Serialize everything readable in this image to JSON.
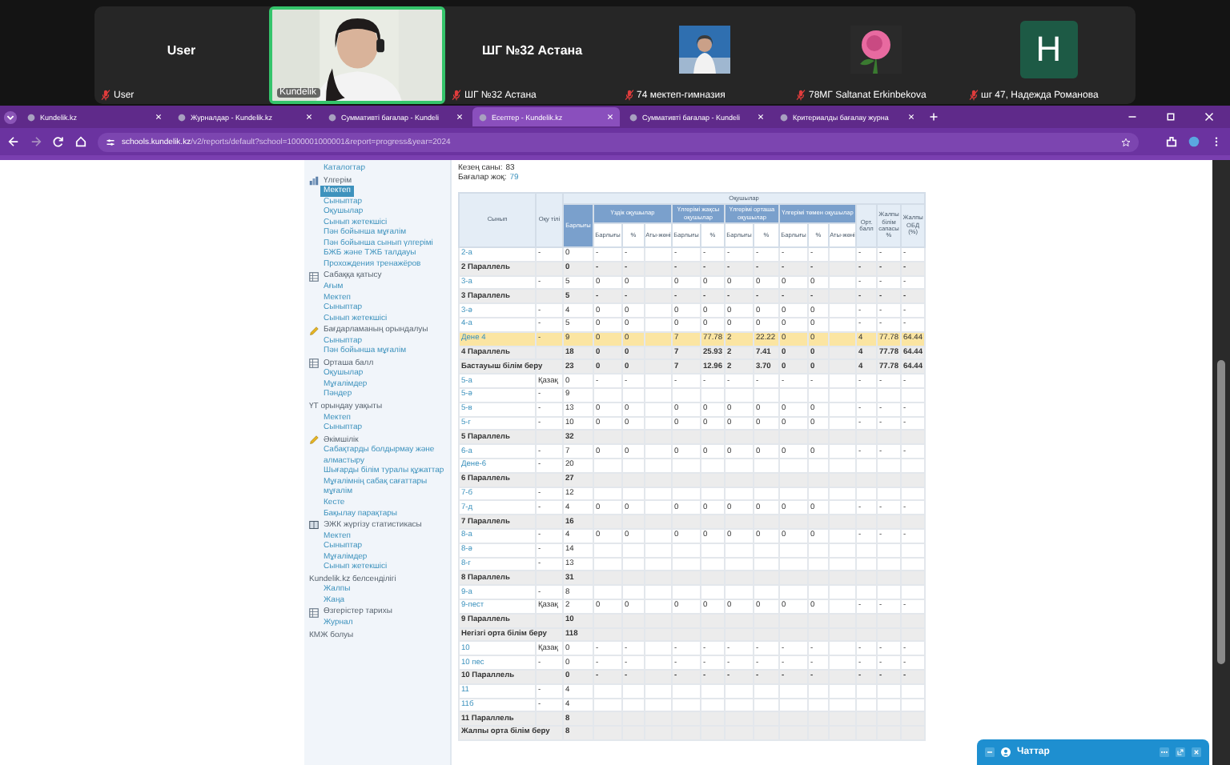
{
  "meeting": {
    "participants": [
      {
        "kind": "name",
        "name": "User",
        "label": "User",
        "muted": true,
        "speaking": false
      },
      {
        "kind": "video",
        "label": "Kundelik",
        "muted": false,
        "speaking": true
      },
      {
        "kind": "name",
        "name": "ШГ №32 Астана",
        "label": "ШГ №32 Астана",
        "muted": true,
        "speaking": false
      },
      {
        "label": "74 мектеп-гимназия",
        "muted": true,
        "speaking": false
      },
      {
        "label": "78МГ Saltanat Erkinbekova",
        "muted": true,
        "speaking": false
      },
      {
        "kind": "avatar",
        "initial": "H",
        "label": "шг 47, Надежда Романова",
        "muted": true,
        "speaking": false
      }
    ]
  },
  "browser": {
    "tabs": [
      {
        "title": "Kundelik.kz",
        "selected": false
      },
      {
        "title": "Журналдар - Kundelik.kz",
        "selected": false
      },
      {
        "title": "Суммативті бағалар - Kundeli",
        "selected": false
      },
      {
        "title": "Есептер - Kundelik.kz",
        "selected": true
      },
      {
        "title": "Суммативті бағалар - Kundeli",
        "selected": false
      },
      {
        "title": "Критериалды бағалау журна",
        "selected": false
      }
    ],
    "url": "**schools.kundelik.kz**/v2/reports/default?school=1000001000001&report=progress&year=2024"
  },
  "sidebar": {
    "groups": [
      {
        "items": [
          {
            "label": "Каталогтар",
            "selected": false
          }
        ]
      },
      {
        "kind": "chart",
        "title": "Үлгерім",
        "items": [
          {
            "label": "Мектеп",
            "selected": true
          },
          {
            "label": "Сыныптар",
            "selected": false
          },
          {
            "label": "Оқушылар",
            "selected": false
          },
          {
            "label": "Сынып жетекшісі",
            "selected": false
          },
          {
            "label": "Пән бойынша мұғалім",
            "selected": false
          },
          {
            "label": "Пән бойынша сынып үлгерімі",
            "selected": false
          },
          {
            "label": "БЖБ және ТЖБ талдауы",
            "selected": false
          },
          {
            "label": "Прохождения тренажёров",
            "selected": false
          }
        ]
      },
      {
        "kind": "grid",
        "title": "Сабаққа қатысу",
        "items": [
          {
            "label": "Ағым",
            "selected": false
          },
          {
            "label": "Мектеп",
            "selected": false
          },
          {
            "label": "Сыныптар",
            "selected": false
          },
          {
            "label": "Сынып жетекшісі",
            "selected": false
          }
        ]
      },
      {
        "kind": "pencil",
        "title": "Бағдарламаның орындалуы",
        "items": [
          {
            "label": "Сыныптар",
            "selected": false
          },
          {
            "label": "Пән бойынша мұғалім",
            "selected": false
          }
        ]
      },
      {
        "kind": "grid",
        "title": "Орташа балл",
        "items": [
          {
            "label": "Оқушылар",
            "selected": false
          },
          {
            "label": "Мұғалімдер",
            "selected": false
          },
          {
            "label": "Пәндер",
            "selected": false
          }
        ]
      },
      {
        "kind": "plain",
        "title": "ҮТ орындау уақыты",
        "items": [
          {
            "label": "Мектеп",
            "selected": false
          },
          {
            "label": "Сыныптар",
            "selected": false
          }
        ]
      },
      {
        "kind": "pencil",
        "title": "Әкімшілік",
        "items": [
          {
            "label": "Сабақтарды болдырмау және алмастыру",
            "selected": false
          },
          {
            "label": "Шығарды білім туралы құжаттар",
            "selected": false
          },
          {
            "label": "Мұғалімнің сабақ сағаттары мұғалім",
            "selected": false
          },
          {
            "label": "Кесте",
            "selected": false
          },
          {
            "label": "Бақылау парақтары",
            "selected": false
          }
        ]
      },
      {
        "kind": "book",
        "title": "ЭЖК жүргізу статистикасы",
        "items": [
          {
            "label": "Мектеп",
            "selected": false
          },
          {
            "label": "Сыныптар",
            "selected": false
          },
          {
            "label": "Мұғалімдер",
            "selected": false
          },
          {
            "label": "Сынып жетекшісі",
            "selected": false
          }
        ]
      },
      {
        "kind": "plain",
        "title": "Kundelik.kz белсенділігі",
        "items": [
          {
            "label": "Жалпы",
            "selected": false
          },
          {
            "label": "Жаңа",
            "selected": false
          }
        ]
      },
      {
        "kind": "grid",
        "title": "Өзгерістер тарихы",
        "items": [
          {
            "label": "Журнал",
            "selected": false
          }
        ]
      },
      {
        "kind": "plain",
        "title": "КМЖ болуы"
      }
    ]
  },
  "report": {
    "stats": [
      {
        "label": "Кезең саны:",
        "value": "83"
      },
      {
        "label": "Бағалар жоқ:",
        "value": "79"
      }
    ],
    "header": {
      "class": "Сынып",
      "language": "Оқу тілі",
      "students": "Оқушылар",
      "total": "Барлығы",
      "groups": [
        {
          "title": "Үздік оқушылар",
          "columns": [
            "Барлығы",
            "%",
            "Аты-жөні"
          ]
        },
        {
          "title": "Үлгерімі жақсы оқушылар",
          "columns": [
            "Барлығы",
            "%"
          ]
        },
        {
          "title": "Үлгерімі орташа оқушылар",
          "columns": [
            "Барлығы",
            "%"
          ]
        },
        {
          "title": "Үлгерімі төмен оқушылар",
          "columns": [
            "Барлығы",
            "%",
            "Аты-жөні"
          ]
        }
      ],
      "tail": [
        "Орт. балл",
        "Жалпы білім сапасы %",
        "Жалпы ОБД (%)"
      ]
    },
    "rows": [
      {
        "kind": "class",
        "highlighted": false,
        "cells": [
          "2-а",
          "-",
          "0",
          "-",
          "-",
          "",
          "-",
          "-",
          "-",
          "-",
          "-",
          "-",
          "",
          "-",
          "-",
          "-"
        ]
      },
      {
        "kind": "summary",
        "highlighted": false,
        "cells": [
          "2 Параллель",
          "",
          "0",
          "-",
          "-",
          "",
          "-",
          "-",
          "-",
          "-",
          "-",
          "-",
          "",
          "-",
          "-",
          "-"
        ]
      },
      {
        "kind": "class",
        "highlighted": false,
        "cells": [
          "3-а",
          "-",
          "5",
          "0",
          "0",
          "",
          "0",
          "0",
          "0",
          "0",
          "0",
          "0",
          "",
          "-",
          "-",
          "-"
        ]
      },
      {
        "kind": "summary",
        "highlighted": false,
        "cells": [
          "3 Параллель",
          "",
          "5",
          "-",
          "-",
          "",
          "-",
          "-",
          "-",
          "-",
          "-",
          "-",
          "",
          "-",
          "-",
          "-"
        ]
      },
      {
        "kind": "class",
        "highlighted": false,
        "cells": [
          "3-ә",
          "-",
          "4",
          "0",
          "0",
          "",
          "0",
          "0",
          "0",
          "0",
          "0",
          "0",
          "",
          "-",
          "-",
          "-"
        ]
      },
      {
        "kind": "class",
        "highlighted": false,
        "cells": [
          "4-а",
          "-",
          "5",
          "0",
          "0",
          "",
          "0",
          "0",
          "0",
          "0",
          "0",
          "0",
          "",
          "-",
          "-",
          "-"
        ]
      },
      {
        "kind": "class",
        "highlighted": true,
        "cells": [
          "Дене 4",
          "-",
          "9",
          "0",
          "0",
          "",
          "7",
          "77.78",
          "2",
          "22.22",
          "0",
          "0",
          "",
          "4",
          "77.78",
          "64.44"
        ]
      },
      {
        "kind": "summary",
        "highlighted": false,
        "cells": [
          "4 Параллель",
          "",
          "18",
          "0",
          "0",
          "",
          "7",
          "25.93",
          "2",
          "7.41",
          "0",
          "0",
          "",
          "4",
          "77.78",
          "64.44"
        ]
      },
      {
        "kind": "summary",
        "highlighted": false,
        "cells": [
          "Бастауыш білім беру",
          "",
          "23",
          "0",
          "0",
          "",
          "7",
          "12.96",
          "2",
          "3.70",
          "0",
          "0",
          "",
          "4",
          "77.78",
          "64.44"
        ]
      },
      {
        "kind": "class",
        "highlighted": false,
        "cells": [
          "5-а",
          "Қазақ",
          "0",
          "-",
          "-",
          "",
          "-",
          "-",
          "-",
          "-",
          "-",
          "-",
          "",
          "-",
          "-",
          "-"
        ]
      },
      {
        "kind": "class",
        "highlighted": false,
        "cells": [
          "5-ә",
          "-",
          "9"
        ]
      },
      {
        "kind": "class",
        "highlighted": false,
        "cells": [
          "5-в",
          "-",
          "13",
          "0",
          "0",
          "",
          "0",
          "0",
          "0",
          "0",
          "0",
          "0",
          "",
          "-",
          "-",
          "-"
        ]
      },
      {
        "kind": "class",
        "highlighted": false,
        "cells": [
          "5-г",
          "-",
          "10",
          "0",
          "0",
          "",
          "0",
          "0",
          "0",
          "0",
          "0",
          "0",
          "",
          "-",
          "-",
          "-"
        ]
      },
      {
        "kind": "summary",
        "highlighted": false,
        "cells": [
          "5 Параллель",
          "",
          "32"
        ]
      },
      {
        "kind": "class",
        "highlighted": false,
        "cells": [
          "6-а",
          "-",
          "7",
          "0",
          "0",
          "",
          "0",
          "0",
          "0",
          "0",
          "0",
          "0",
          "",
          "-",
          "-",
          "-"
        ]
      },
      {
        "kind": "class",
        "highlighted": false,
        "cells": [
          "Дене-6",
          "-",
          "20"
        ]
      },
      {
        "kind": "summary",
        "highlighted": false,
        "cells": [
          "6 Параллель",
          "",
          "27"
        ]
      },
      {
        "kind": "class",
        "highlighted": false,
        "cells": [
          "7-б",
          "-",
          "12"
        ]
      },
      {
        "kind": "class",
        "highlighted": false,
        "cells": [
          "7-д",
          "-",
          "4",
          "0",
          "0",
          "",
          "0",
          "0",
          "0",
          "0",
          "0",
          "0",
          "",
          "-",
          "-",
          "-"
        ]
      },
      {
        "kind": "summary",
        "highlighted": false,
        "cells": [
          "7 Параллель",
          "",
          "16"
        ]
      },
      {
        "kind": "class",
        "highlighted": false,
        "cells": [
          "8-а",
          "-",
          "4",
          "0",
          "0",
          "",
          "0",
          "0",
          "0",
          "0",
          "0",
          "0",
          "",
          "-",
          "-",
          "-"
        ]
      },
      {
        "kind": "class",
        "highlighted": false,
        "cells": [
          "8-ә",
          "-",
          "14"
        ]
      },
      {
        "kind": "class",
        "highlighted": false,
        "cells": [
          "8-г",
          "-",
          "13"
        ]
      },
      {
        "kind": "summary",
        "highlighted": false,
        "cells": [
          "8 Параллель",
          "",
          "31"
        ]
      },
      {
        "kind": "class",
        "highlighted": false,
        "cells": [
          "9-а",
          "-",
          "8"
        ]
      },
      {
        "kind": "class",
        "highlighted": false,
        "cells": [
          "9-пест",
          "Қазақ",
          "2",
          "0",
          "0",
          "",
          "0",
          "0",
          "0",
          "0",
          "0",
          "0",
          "",
          "-",
          "-",
          "-"
        ]
      },
      {
        "kind": "summary",
        "highlighted": false,
        "cells": [
          "9 Параллель",
          "",
          "10"
        ]
      },
      {
        "kind": "summary",
        "highlighted": false,
        "cells": [
          "Негізгі орта білім беру",
          "",
          "118"
        ]
      },
      {
        "kind": "class",
        "highlighted": false,
        "cells": [
          "10",
          "Қазақ",
          "0",
          "-",
          "-",
          "",
          "-",
          "-",
          "-",
          "-",
          "-",
          "-",
          "",
          "-",
          "-",
          "-"
        ]
      },
      {
        "kind": "class",
        "highlighted": false,
        "cells": [
          "10 пес",
          "-",
          "0",
          "-",
          "-",
          "",
          "-",
          "-",
          "-",
          "-",
          "-",
          "-",
          "",
          "-",
          "-",
          "-"
        ]
      },
      {
        "kind": "summary",
        "highlighted": false,
        "cells": [
          "10 Параллель",
          "",
          "0",
          "-",
          "-",
          "",
          "-",
          "-",
          "-",
          "-",
          "-",
          "-",
          "",
          "-",
          "-",
          "-"
        ]
      },
      {
        "kind": "class",
        "highlighted": false,
        "cells": [
          "11",
          "-",
          "4"
        ]
      },
      {
        "kind": "class",
        "highlighted": false,
        "cells": [
          "11б",
          "-",
          "4"
        ]
      },
      {
        "kind": "summary",
        "highlighted": false,
        "cells": [
          "11 Параллель",
          "",
          "8"
        ]
      },
      {
        "kind": "summary",
        "highlighted": false,
        "cells": [
          "Жалпы орта білім беру",
          "",
          "8"
        ]
      }
    ]
  },
  "chat": {
    "title": "Чаттар"
  }
}
